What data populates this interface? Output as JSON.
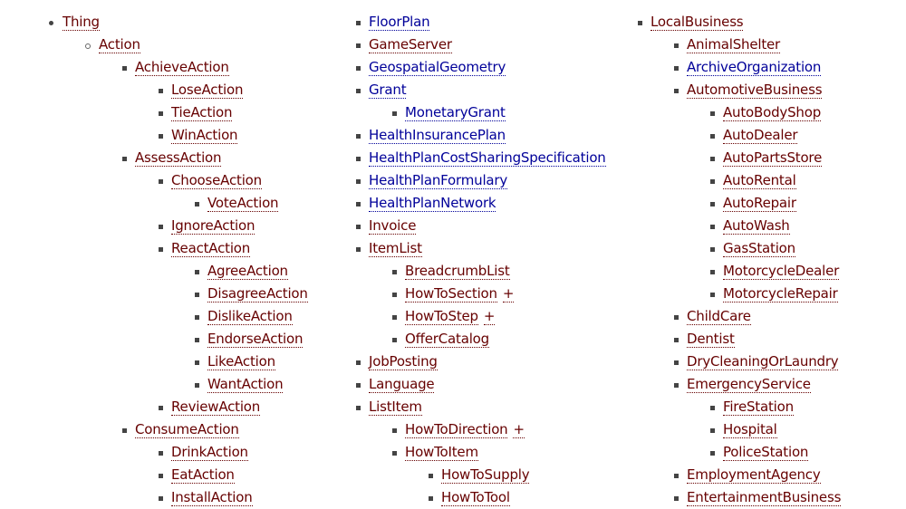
{
  "colors": {
    "visited": "#660000",
    "link": "#000099"
  },
  "columns": [
    {
      "items": [
        {
          "label": "Thing",
          "level": 0,
          "bullet": "disc"
        },
        {
          "label": "Action",
          "level": 1,
          "bullet": "circle"
        },
        {
          "label": "AchieveAction",
          "level": 2
        },
        {
          "label": "LoseAction",
          "level": 3
        },
        {
          "label": "TieAction",
          "level": 3
        },
        {
          "label": "WinAction",
          "level": 3
        },
        {
          "label": "AssessAction",
          "level": 2
        },
        {
          "label": "ChooseAction",
          "level": 3
        },
        {
          "label": "VoteAction",
          "level": 4
        },
        {
          "label": "IgnoreAction",
          "level": 3
        },
        {
          "label": "ReactAction",
          "level": 3
        },
        {
          "label": "AgreeAction",
          "level": 4
        },
        {
          "label": "DisagreeAction",
          "level": 4
        },
        {
          "label": "DislikeAction",
          "level": 4
        },
        {
          "label": "EndorseAction",
          "level": 4
        },
        {
          "label": "LikeAction",
          "level": 4
        },
        {
          "label": "WantAction",
          "level": 4
        },
        {
          "label": "ReviewAction",
          "level": 3
        },
        {
          "label": "ConsumeAction",
          "level": 2
        },
        {
          "label": "DrinkAction",
          "level": 3
        },
        {
          "label": "EatAction",
          "level": 3
        },
        {
          "label": "InstallAction",
          "level": 3
        }
      ]
    },
    {
      "items": [
        {
          "label": "FloorPlan",
          "level": 0,
          "blue": true
        },
        {
          "label": "GameServer",
          "level": 0
        },
        {
          "label": "GeospatialGeometry",
          "level": 0,
          "blue": true
        },
        {
          "label": "Grant",
          "level": 0,
          "blue": true
        },
        {
          "label": "MonetaryGrant",
          "level": 1,
          "blue": true
        },
        {
          "label": "HealthInsurancePlan",
          "level": 0,
          "blue": true
        },
        {
          "label": "HealthPlanCostSharingSpecification",
          "level": 0,
          "blue": true
        },
        {
          "label": "HealthPlanFormulary",
          "level": 0,
          "blue": true
        },
        {
          "label": "HealthPlanNetwork",
          "level": 0,
          "blue": true
        },
        {
          "label": "Invoice",
          "level": 0
        },
        {
          "label": "ItemList",
          "level": 0
        },
        {
          "label": "BreadcrumbList",
          "level": 1
        },
        {
          "label": "HowToSection",
          "level": 1,
          "plus": "+"
        },
        {
          "label": "HowToStep",
          "level": 1,
          "plus": "+"
        },
        {
          "label": "OfferCatalog",
          "level": 1
        },
        {
          "label": "JobPosting",
          "level": 0
        },
        {
          "label": "Language",
          "level": 0
        },
        {
          "label": "ListItem",
          "level": 0
        },
        {
          "label": "HowToDirection",
          "level": 1,
          "plus": "+"
        },
        {
          "label": "HowToItem",
          "level": 1
        },
        {
          "label": "HowToSupply",
          "level": 2
        },
        {
          "label": "HowToTool",
          "level": 2
        }
      ]
    },
    {
      "items": [
        {
          "label": "LocalBusiness",
          "level": 0
        },
        {
          "label": "AnimalShelter",
          "level": 1
        },
        {
          "label": "ArchiveOrganization",
          "level": 1,
          "blue": true
        },
        {
          "label": "AutomotiveBusiness",
          "level": 1
        },
        {
          "label": "AutoBodyShop",
          "level": 2
        },
        {
          "label": "AutoDealer",
          "level": 2
        },
        {
          "label": "AutoPartsStore",
          "level": 2
        },
        {
          "label": "AutoRental",
          "level": 2
        },
        {
          "label": "AutoRepair",
          "level": 2
        },
        {
          "label": "AutoWash",
          "level": 2
        },
        {
          "label": "GasStation",
          "level": 2
        },
        {
          "label": "MotorcycleDealer",
          "level": 2
        },
        {
          "label": "MotorcycleRepair",
          "level": 2
        },
        {
          "label": "ChildCare",
          "level": 1
        },
        {
          "label": "Dentist",
          "level": 1
        },
        {
          "label": "DryCleaningOrLaundry",
          "level": 1
        },
        {
          "label": "EmergencyService",
          "level": 1
        },
        {
          "label": "FireStation",
          "level": 2
        },
        {
          "label": "Hospital",
          "level": 2
        },
        {
          "label": "PoliceStation",
          "level": 2
        },
        {
          "label": "EmploymentAgency",
          "level": 1
        },
        {
          "label": "EntertainmentBusiness",
          "level": 1
        }
      ]
    }
  ]
}
